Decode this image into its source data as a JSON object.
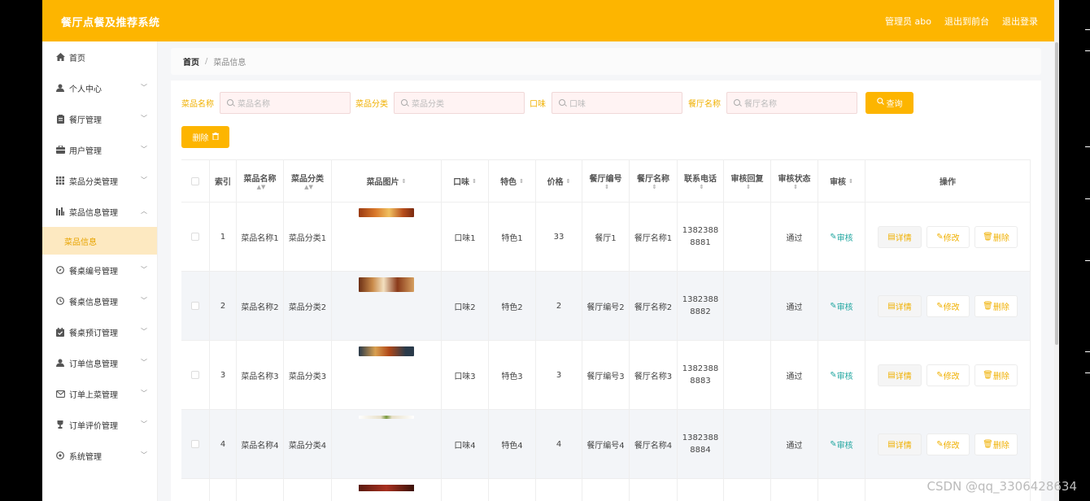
{
  "app": {
    "title": "餐厅点餐及推荐系统"
  },
  "topbar": {
    "user": "管理员 abo",
    "to_front": "退出到前台",
    "logout": "退出登录"
  },
  "sidebar": {
    "items": [
      {
        "label": "首页",
        "icon": "home-icon"
      },
      {
        "label": "个人中心",
        "icon": "user-icon"
      },
      {
        "label": "餐厅管理",
        "icon": "clipboard-icon"
      },
      {
        "label": "用户管理",
        "icon": "briefcase-icon"
      },
      {
        "label": "菜品分类管理",
        "icon": "grid-icon"
      },
      {
        "label": "菜品信息管理",
        "icon": "chart-icon"
      },
      {
        "label": "餐桌编号管理",
        "icon": "compass-icon"
      },
      {
        "label": "餐桌信息管理",
        "icon": "clock-icon"
      },
      {
        "label": "餐桌预订管理",
        "icon": "calendar-icon"
      },
      {
        "label": "订单信息管理",
        "icon": "user-icon"
      },
      {
        "label": "订单上菜管理",
        "icon": "mail-icon"
      },
      {
        "label": "订单评价管理",
        "icon": "trophy-icon"
      },
      {
        "label": "系统管理",
        "icon": "settings-icon"
      }
    ],
    "active_sub": "菜品信息"
  },
  "breadcrumb": {
    "home": "首页",
    "sep": "/",
    "current": "菜品信息"
  },
  "search": {
    "fields": [
      {
        "label": "菜品名称",
        "placeholder": "菜品名称"
      },
      {
        "label": "菜品分类",
        "placeholder": "菜品分类"
      },
      {
        "label": "口味",
        "placeholder": "口味"
      },
      {
        "label": "餐厅名称",
        "placeholder": "餐厅名称"
      }
    ],
    "query_label": "查询"
  },
  "toolbar": {
    "delete_label": "删除"
  },
  "table": {
    "columns": [
      "索引",
      "菜品名称",
      "菜品分类",
      "菜品图片",
      "口味",
      "特色",
      "价格",
      "餐厅编号",
      "餐厅名称",
      "联系电话",
      "审核回复",
      "审核状态",
      "审核",
      "操作"
    ],
    "rows": [
      {
        "idx": "1",
        "name": "菜品名称1",
        "cat": "菜品分类1",
        "taste": "口味1",
        "feature": "特色1",
        "price": "33",
        "rid": "餐厅1",
        "rname": "餐厅名称1",
        "tel1": "1382388",
        "tel2": "8881",
        "reply": "",
        "status": "通过"
      },
      {
        "idx": "2",
        "name": "菜品名称2",
        "cat": "菜品分类2",
        "taste": "口味2",
        "feature": "特色2",
        "price": "2",
        "rid": "餐厅编号2",
        "rname": "餐厅名称2",
        "tel1": "1382388",
        "tel2": "8882",
        "reply": "",
        "status": "通过"
      },
      {
        "idx": "3",
        "name": "菜品名称3",
        "cat": "菜品分类3",
        "taste": "口味3",
        "feature": "特色3",
        "price": "3",
        "rid": "餐厅编号3",
        "rname": "餐厅名称3",
        "tel1": "1382388",
        "tel2": "8883",
        "reply": "",
        "status": "通过"
      },
      {
        "idx": "4",
        "name": "菜品名称4",
        "cat": "菜品分类4",
        "taste": "口味4",
        "feature": "特色4",
        "price": "4",
        "rid": "餐厅编号4",
        "rname": "餐厅名称4",
        "tel1": "1382388",
        "tel2": "8884",
        "reply": "",
        "status": "通过"
      }
    ],
    "audit_label": "审核",
    "detail_label": "详情",
    "edit_label": "修改",
    "delete_label": "删除"
  },
  "colors": {
    "accent": "#fdb500",
    "audit": "#21a6a0"
  },
  "watermark": "CSDN @qq_3306428634"
}
